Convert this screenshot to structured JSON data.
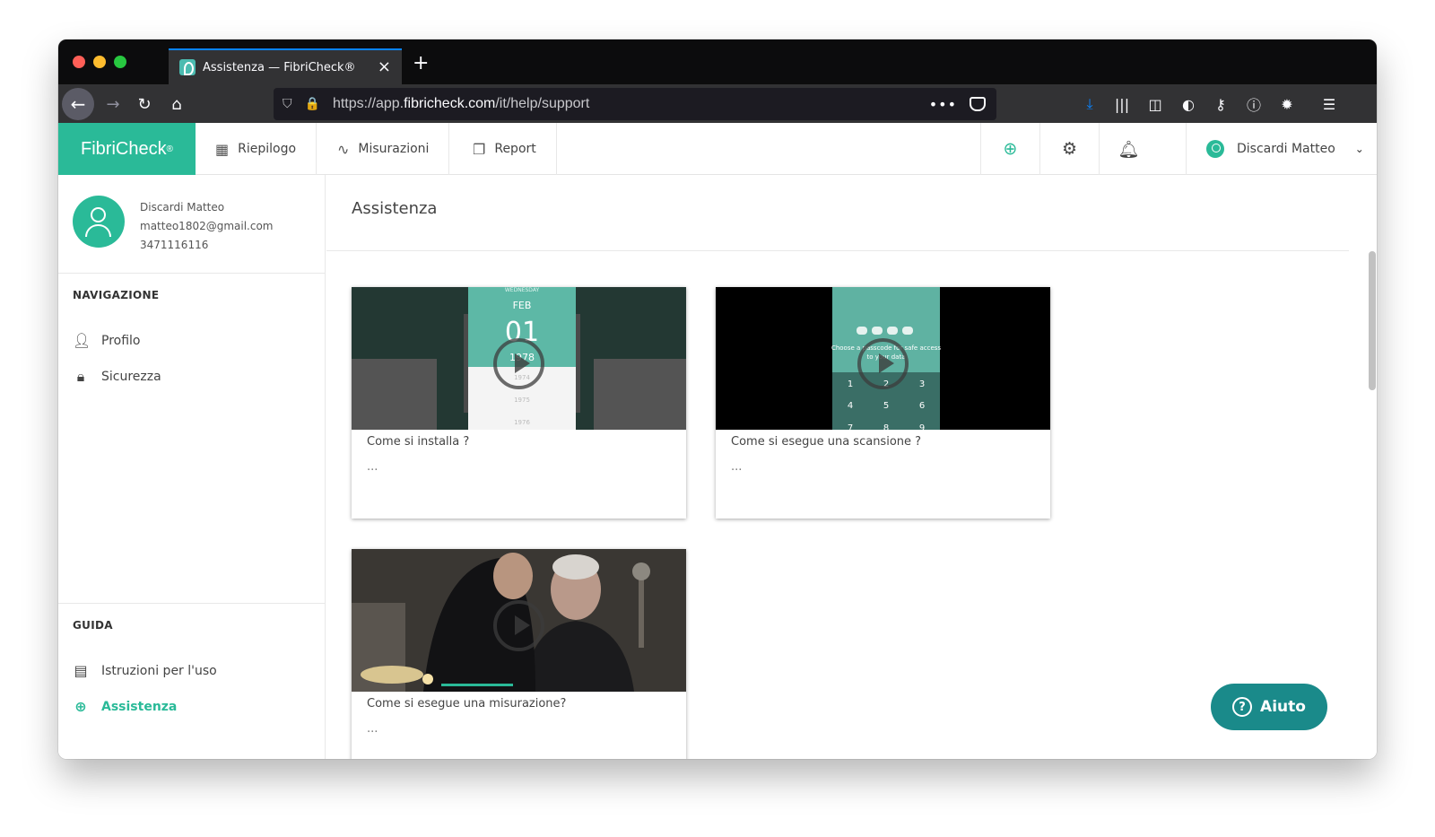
{
  "browser": {
    "tab_title": "Assistenza — FibriCheck®",
    "url_prefix": "https://app.",
    "url_domain": "fibricheck.com",
    "url_path": "/it/help/support",
    "url_more": "•••"
  },
  "app": {
    "logo": "FibriCheck",
    "logo_mark": "®",
    "nav": [
      {
        "label": "Riepilogo",
        "icon": "grid-icon"
      },
      {
        "label": "Misurazioni",
        "icon": "pulse-icon"
      },
      {
        "label": "Report",
        "icon": "documents-icon"
      }
    ],
    "user_name": "Discardi Matteo"
  },
  "sidebar": {
    "profile": {
      "name": "Discardi Matteo",
      "email": "matteo1802@gmail.com",
      "phone": "3471116116"
    },
    "nav_section": "NAVIGAZIONE",
    "nav_items": [
      {
        "label": "Profilo",
        "icon": "user-icon"
      },
      {
        "label": "Sicurezza",
        "icon": "lock-icon"
      }
    ],
    "guide_section": "GUIDA",
    "guide_items": [
      {
        "label": "Istruzioni per l'uso",
        "icon": "book-icon"
      },
      {
        "label": "Assistenza",
        "icon": "lifebuoy-icon"
      }
    ]
  },
  "main": {
    "title": "Assistenza",
    "videos": [
      {
        "title": "Come si installa ?",
        "desc": "..."
      },
      {
        "title": "Come si esegue una scansione ?",
        "desc": "..."
      },
      {
        "title": "Come si esegue una misurazione?",
        "desc": "..."
      }
    ],
    "thumb_text": {
      "wednesday": "WEDNESDAY",
      "month": "FEB",
      "day": "01",
      "years": [
        "1974",
        "1975",
        "1976"
      ],
      "year_selected": "1978",
      "passcode_line1": "Choose a passcode for safe access",
      "passcode_line2": "to your data",
      "keypad": [
        "1",
        "2",
        "3",
        "4",
        "5",
        "6",
        "7",
        "8",
        "9"
      ]
    },
    "help_button": "Aiuto",
    "help_icon": "?"
  },
  "colors": {
    "brand": "#2aba98",
    "help_button": "#1a8a8a",
    "browser_chrome": "#0c0c0d"
  }
}
